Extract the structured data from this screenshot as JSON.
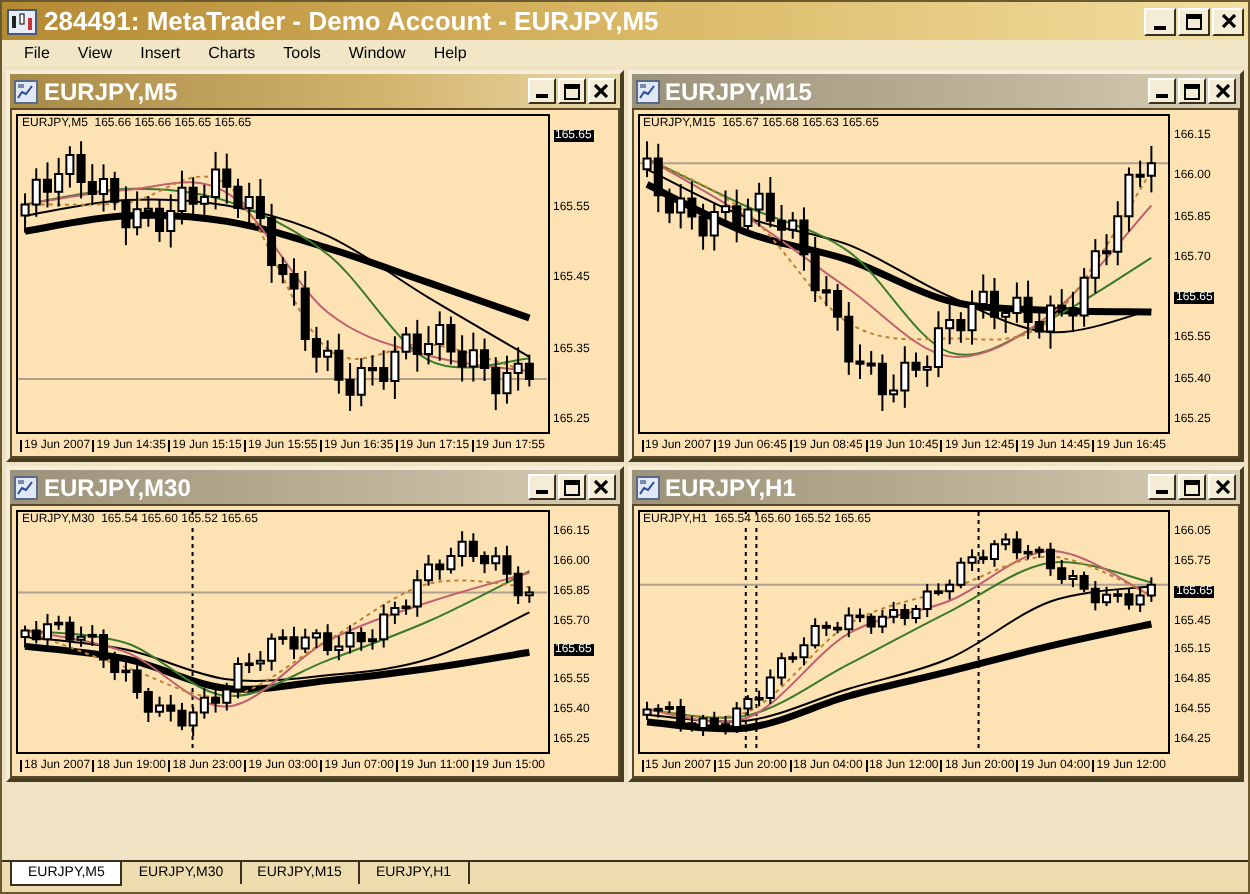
{
  "window": {
    "title": "284491: MetaTrader - Demo Account - EURJPY,M5"
  },
  "menu": [
    "File",
    "View",
    "Insert",
    "Charts",
    "Tools",
    "Window",
    "Help"
  ],
  "charts": [
    {
      "title": "EURJPY,M5",
      "active": true,
      "legend": "EURJPY,M5  165.66 165.66 165.65 165.65",
      "y_axis": [
        {
          "kind": "price",
          "text": "165.65"
        },
        {
          "kind": "tick",
          "text": "165.55"
        },
        {
          "kind": "tick",
          "text": "165.45"
        },
        {
          "kind": "tick",
          "text": "165.35"
        },
        {
          "kind": "tick",
          "text": "165.25"
        }
      ],
      "x_axis": [
        "19 Jun 2007",
        "19 Jun 14:35",
        "19 Jun 15:15",
        "19 Jun 15:55",
        "19 Jun 16:35",
        "19 Jun 17:15",
        "19 Jun 17:55"
      ]
    },
    {
      "title": "EURJPY,M15",
      "active": false,
      "legend": "EURJPY,M15  165.67 165.68 165.63 165.65",
      "y_axis": [
        {
          "kind": "tick",
          "text": "166.15"
        },
        {
          "kind": "tick",
          "text": "166.00"
        },
        {
          "kind": "tick",
          "text": "165.85"
        },
        {
          "kind": "tick",
          "text": "165.70"
        },
        {
          "kind": "price",
          "text": "165.65"
        },
        {
          "kind": "tick",
          "text": "165.55"
        },
        {
          "kind": "tick",
          "text": "165.40"
        },
        {
          "kind": "tick",
          "text": "165.25"
        }
      ],
      "x_axis": [
        "19 Jun 2007",
        "19 Jun 06:45",
        "19 Jun 08:45",
        "19 Jun 10:45",
        "19 Jun 12:45",
        "19 Jun 14:45",
        "19 Jun 16:45"
      ]
    },
    {
      "title": "EURJPY,M30",
      "active": false,
      "legend": "EURJPY,M30  165.54 165.60 165.52 165.65",
      "y_axis": [
        {
          "kind": "tick",
          "text": "166.15"
        },
        {
          "kind": "tick",
          "text": "166.00"
        },
        {
          "kind": "tick",
          "text": "165.85"
        },
        {
          "kind": "tick",
          "text": "165.70"
        },
        {
          "kind": "price",
          "text": "165.65"
        },
        {
          "kind": "tick",
          "text": "165.55"
        },
        {
          "kind": "tick",
          "text": "165.40"
        },
        {
          "kind": "tick",
          "text": "165.25"
        }
      ],
      "x_axis": [
        "18 Jun 2007",
        "18 Jun 19:00",
        "18 Jun 23:00",
        "19 Jun 03:00",
        "19 Jun 07:00",
        "19 Jun 11:00",
        "19 Jun 15:00"
      ]
    },
    {
      "title": "EURJPY,H1",
      "active": false,
      "legend": "EURJPY,H1  165.54 165.60 165.52 165.65",
      "y_axis": [
        {
          "kind": "tick",
          "text": "166.05"
        },
        {
          "kind": "tick",
          "text": "165.75"
        },
        {
          "kind": "price",
          "text": "165.65"
        },
        {
          "kind": "tick",
          "text": "165.45"
        },
        {
          "kind": "tick",
          "text": "165.15"
        },
        {
          "kind": "tick",
          "text": "164.85"
        },
        {
          "kind": "tick",
          "text": "164.55"
        },
        {
          "kind": "tick",
          "text": "164.25"
        }
      ],
      "x_axis": [
        "15 Jun 2007",
        "15 Jun 20:00",
        "18 Jun 04:00",
        "18 Jun 12:00",
        "18 Jun 20:00",
        "19 Jun 04:00",
        "19 Jun 12:00"
      ]
    }
  ],
  "tabs": [
    {
      "label": "EURJPY,M5",
      "selected": true
    },
    {
      "label": "EURJPY,M30",
      "selected": false
    },
    {
      "label": "EURJPY,M15",
      "selected": false
    },
    {
      "label": "EURJPY,H1",
      "selected": false
    }
  ]
}
